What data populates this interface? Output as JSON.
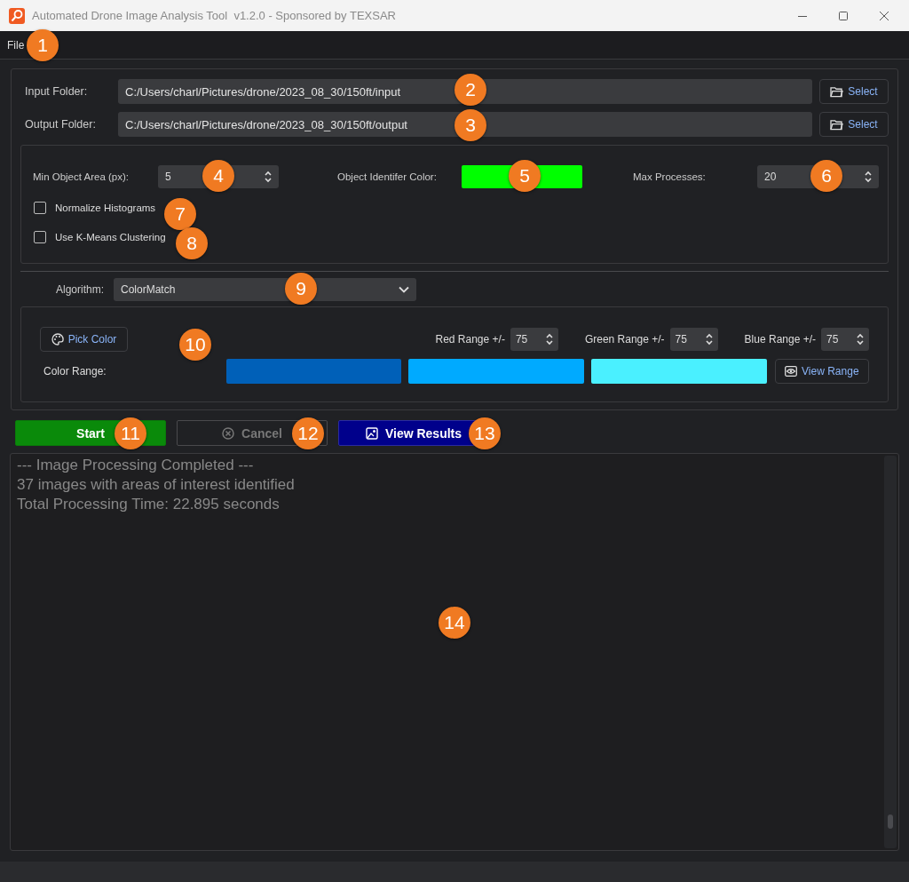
{
  "window": {
    "title": "Automated Drone Image Analysis Tool  v1.2.0 - Sponsored by TEXSAR"
  },
  "menu": [
    "File"
  ],
  "folders": [
    {
      "label": "Input Folder:",
      "value": "C:/Users/charl/Pictures/drone/2023_08_30/150ft/input",
      "button": "Select"
    },
    {
      "label": "Output Folder:",
      "value": "C:/Users/charl/Pictures/drone/2023_08_30/150ft/output",
      "button": "Select"
    }
  ],
  "options": {
    "min_object_area": {
      "label": "Min Object Area (px):",
      "value": "5"
    },
    "identifier_color": {
      "label": "Object Identifer Color:",
      "color": "#00ff00"
    },
    "max_processes": {
      "label": "Max Processes:",
      "value": "20"
    },
    "checkboxes": [
      {
        "label": "Normalize Histograms",
        "checked": false
      },
      {
        "label": "Use K-Means Clustering",
        "checked": false
      }
    ]
  },
  "algorithm": {
    "label": "Algorithm:",
    "value": "ColorMatch"
  },
  "color_match": {
    "pick_button": "Pick Color",
    "ranges": [
      {
        "label": "Red Range +/-",
        "value": "75"
      },
      {
        "label": "Green Range +/-",
        "value": "75"
      },
      {
        "label": "Blue Range +/-",
        "value": "75"
      }
    ],
    "color_range_label": "Color Range:",
    "swatches": [
      {
        "color": "#0060b8"
      },
      {
        "color": "#00aaff"
      },
      {
        "color": "#4af0ff"
      }
    ],
    "view_button": "View Range"
  },
  "actions": [
    {
      "label": "Start",
      "kind": "start",
      "disabled": false
    },
    {
      "label": "Cancel",
      "kind": "cancel",
      "disabled": true
    },
    {
      "label": "View Results",
      "kind": "results",
      "disabled": false
    }
  ],
  "log": [
    "--- Image Processing Completed ---",
    "37 images with areas of interest identified",
    "Total Processing Time: 22.895 seconds"
  ],
  "callouts": [
    "1",
    "2",
    "3",
    "4",
    "5",
    "6",
    "7",
    "8",
    "9",
    "10",
    "11",
    "12",
    "13",
    "14"
  ]
}
